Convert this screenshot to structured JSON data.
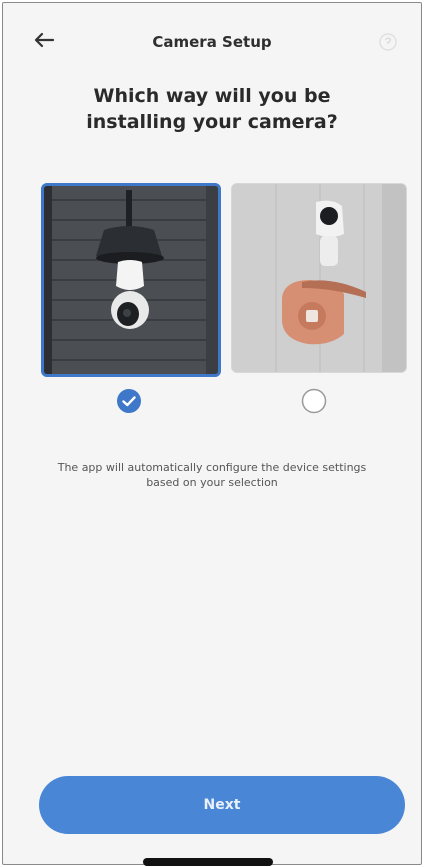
{
  "header": {
    "title": "Camera Setup",
    "back_icon": "arrow-left-icon",
    "help_icon": "help-icon"
  },
  "question": "Which way will you be installing your camera?",
  "options": [
    {
      "name": "pendant-mount",
      "selected": true
    },
    {
      "name": "wall-mount",
      "selected": false
    }
  ],
  "hint": "The app will automatically configure the device settings based on your selection",
  "footer": {
    "next_label": "Next"
  },
  "colors": {
    "accent": "#4a86d6",
    "selected_border": "#3f78c8",
    "background": "#f5f5f5"
  }
}
